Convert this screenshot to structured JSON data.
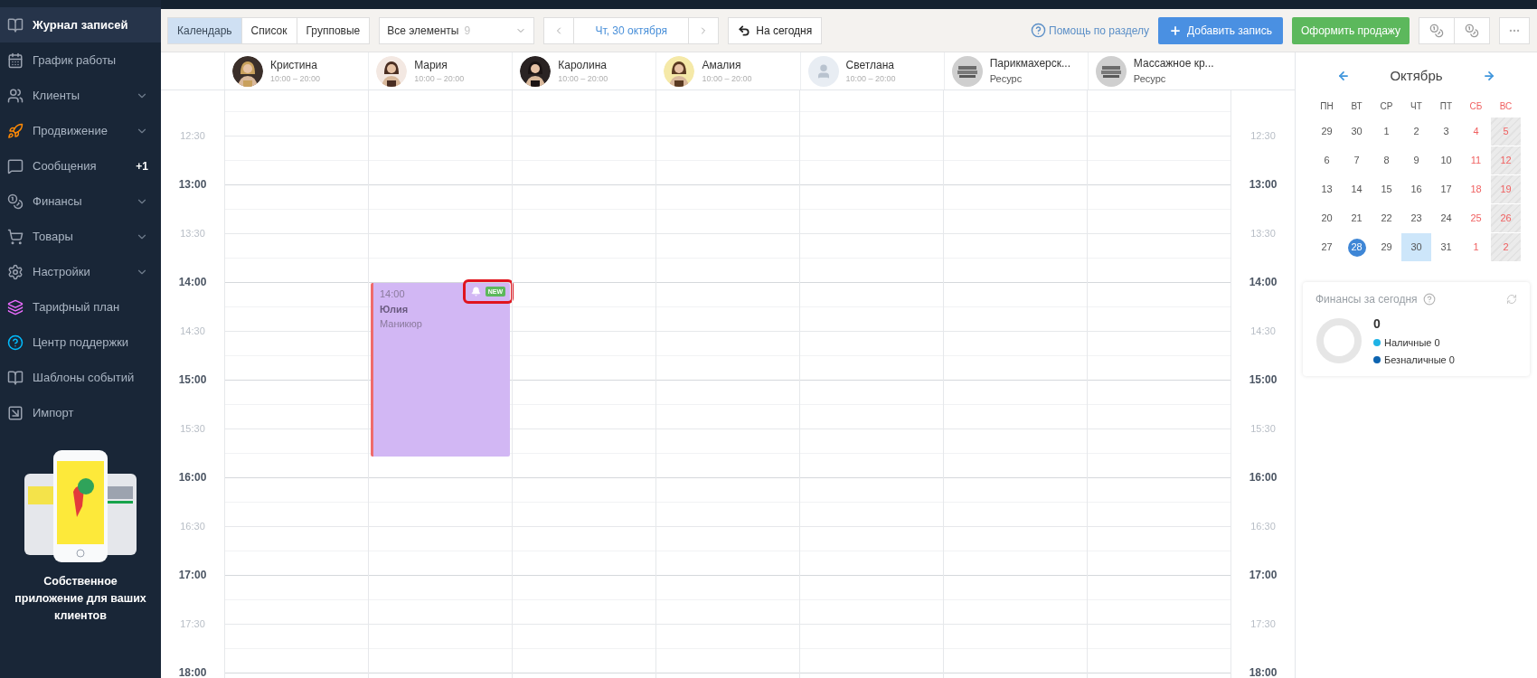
{
  "sidebar": {
    "items": [
      {
        "label": "Журнал записей",
        "selected": true,
        "expandable": false
      },
      {
        "label": "График работы",
        "selected": false,
        "expandable": false
      },
      {
        "label": "Клиенты",
        "selected": false,
        "expandable": true
      },
      {
        "label": "Продвижение",
        "selected": false,
        "expandable": true
      },
      {
        "label": "Сообщения",
        "selected": false,
        "expandable": false,
        "badge": "+1"
      },
      {
        "label": "Финансы",
        "selected": false,
        "expandable": true
      },
      {
        "label": "Товары",
        "selected": false,
        "expandable": true
      },
      {
        "label": "Настройки",
        "selected": false,
        "expandable": true
      },
      {
        "label": "Тарифный план",
        "selected": false,
        "expandable": false
      },
      {
        "label": "Центр поддержки",
        "selected": false,
        "expandable": false
      },
      {
        "label": "Шаблоны событий",
        "selected": false,
        "expandable": false
      },
      {
        "label": "Импорт",
        "selected": false,
        "expandable": false
      }
    ],
    "promo": {
      "text": "Собственное приложение для ваших клиентов"
    }
  },
  "toolbar": {
    "view_tabs": [
      {
        "label": "Календарь",
        "selected": true
      },
      {
        "label": "Список",
        "selected": false
      },
      {
        "label": "Групповые",
        "selected": false
      }
    ],
    "filter": {
      "value": "Все элементы",
      "count": "9"
    },
    "date": "Чт, 30 октября",
    "today_button": "На сегодня",
    "help_link": "Помощь по разделу",
    "add_button": "Добавить запись",
    "sale_button": "Оформить продажу"
  },
  "staff": [
    {
      "name": "Кристина",
      "subtitle": "10:00 – 20:00"
    },
    {
      "name": "Мария",
      "subtitle": "10:00 – 20:00",
      "events": [
        {
          "time": "14:00",
          "client": "Юлия",
          "service": "Маникюр",
          "badge": "NEW",
          "highlighted": true
        }
      ]
    },
    {
      "name": "Каролина",
      "subtitle": "10:00 – 20:00"
    },
    {
      "name": "Амалия",
      "subtitle": "10:00 – 20:00"
    },
    {
      "name": "Светлана",
      "subtitle": "10:00 – 20:00",
      "kind": "placeholder"
    },
    {
      "name": "Парикмахерск...",
      "subtitle": "Ресурс",
      "kind": "resource"
    },
    {
      "name": "Массажное кр...",
      "subtitle": "Ресурс",
      "kind": "resource"
    }
  ],
  "time_labels_left": [
    {
      "label": "12:30",
      "kind": "half"
    },
    {
      "label": "13:00",
      "kind": "hour"
    },
    {
      "label": "13:30",
      "kind": "half"
    },
    {
      "label": "14:00",
      "kind": "hour"
    },
    {
      "label": "14:30",
      "kind": "half"
    },
    {
      "label": "15:00",
      "kind": "hour"
    },
    {
      "label": "15:30",
      "kind": "half"
    },
    {
      "label": "16:00",
      "kind": "hour"
    },
    {
      "label": "16:30",
      "kind": "half"
    },
    {
      "label": "17:00",
      "kind": "hour"
    },
    {
      "label": "17:30",
      "kind": "half"
    },
    {
      "label": "18:00",
      "kind": "hour"
    }
  ],
  "time_labels_right": [
    {
      "label": "12:30",
      "kind": "half"
    },
    {
      "label": "13:00",
      "kind": "hour"
    },
    {
      "label": "13:30",
      "kind": "half"
    },
    {
      "label": "14:00",
      "kind": "hour"
    },
    {
      "label": "14:30",
      "kind": "half"
    },
    {
      "label": "15:00",
      "kind": "hour"
    },
    {
      "label": "15:30",
      "kind": "half"
    },
    {
      "label": "16:00",
      "kind": "hour"
    },
    {
      "label": "16:30",
      "kind": "half"
    },
    {
      "label": "17:00",
      "kind": "hour"
    },
    {
      "label": "17:30",
      "kind": "half"
    },
    {
      "label": "18:00",
      "kind": "hour"
    }
  ],
  "mini_calendar": {
    "month": "Октябрь",
    "weekdays": [
      {
        "label": "ПН",
        "weekend": false
      },
      {
        "label": "ВТ",
        "weekend": false
      },
      {
        "label": "СР",
        "weekend": false
      },
      {
        "label": "ЧТ",
        "weekend": false
      },
      {
        "label": "ПТ",
        "weekend": false
      },
      {
        "label": "СБ",
        "weekend": true
      },
      {
        "label": "ВС",
        "weekend": true
      }
    ],
    "weeks": [
      [
        {
          "label": "29",
          "weekend": false,
          "day_off": false,
          "selected": false,
          "today": false
        },
        {
          "label": "30",
          "weekend": false,
          "day_off": false,
          "selected": false,
          "today": false
        },
        {
          "label": "1",
          "weekend": false,
          "day_off": false,
          "selected": false,
          "today": false
        },
        {
          "label": "2",
          "weekend": false,
          "day_off": false,
          "selected": false,
          "today": false
        },
        {
          "label": "3",
          "weekend": false,
          "day_off": false,
          "selected": false,
          "today": false
        },
        {
          "label": "4",
          "weekend": true,
          "day_off": false,
          "selected": false,
          "today": false
        },
        {
          "label": "5",
          "weekend": true,
          "day_off": true,
          "selected": false,
          "today": false
        }
      ],
      [
        {
          "label": "6",
          "weekend": false,
          "day_off": false,
          "selected": false,
          "today": false
        },
        {
          "label": "7",
          "weekend": false,
          "day_off": false,
          "selected": false,
          "today": false
        },
        {
          "label": "8",
          "weekend": false,
          "day_off": false,
          "selected": false,
          "today": false
        },
        {
          "label": "9",
          "weekend": false,
          "day_off": false,
          "selected": false,
          "today": false
        },
        {
          "label": "10",
          "weekend": false,
          "day_off": false,
          "selected": false,
          "today": false
        },
        {
          "label": "11",
          "weekend": true,
          "day_off": false,
          "selected": false,
          "today": false
        },
        {
          "label": "12",
          "weekend": true,
          "day_off": true,
          "selected": false,
          "today": false
        }
      ],
      [
        {
          "label": "13",
          "weekend": false,
          "day_off": false,
          "selected": false,
          "today": false
        },
        {
          "label": "14",
          "weekend": false,
          "day_off": false,
          "selected": false,
          "today": false
        },
        {
          "label": "15",
          "weekend": false,
          "day_off": false,
          "selected": false,
          "today": false
        },
        {
          "label": "16",
          "weekend": false,
          "day_off": false,
          "selected": false,
          "today": false
        },
        {
          "label": "17",
          "weekend": false,
          "day_off": false,
          "selected": false,
          "today": false
        },
        {
          "label": "18",
          "weekend": true,
          "day_off": false,
          "selected": false,
          "today": false
        },
        {
          "label": "19",
          "weekend": true,
          "day_off": true,
          "selected": false,
          "today": false
        }
      ],
      [
        {
          "label": "20",
          "weekend": false,
          "day_off": false,
          "selected": false,
          "today": false
        },
        {
          "label": "21",
          "weekend": false,
          "day_off": false,
          "selected": false,
          "today": false
        },
        {
          "label": "22",
          "weekend": false,
          "day_off": false,
          "selected": false,
          "today": false
        },
        {
          "label": "23",
          "weekend": false,
          "day_off": false,
          "selected": false,
          "today": false
        },
        {
          "label": "24",
          "weekend": false,
          "day_off": false,
          "selected": false,
          "today": false
        },
        {
          "label": "25",
          "weekend": true,
          "day_off": false,
          "selected": false,
          "today": false
        },
        {
          "label": "26",
          "weekend": true,
          "day_off": true,
          "selected": false,
          "today": false
        }
      ],
      [
        {
          "label": "27",
          "weekend": false,
          "day_off": false,
          "selected": false,
          "today": false
        },
        {
          "label": "28",
          "weekend": false,
          "day_off": false,
          "selected": false,
          "today": true
        },
        {
          "label": "29",
          "weekend": false,
          "day_off": false,
          "selected": false,
          "today": false
        },
        {
          "label": "30",
          "weekend": false,
          "day_off": false,
          "selected": true,
          "today": false
        },
        {
          "label": "31",
          "weekend": false,
          "day_off": false,
          "selected": false,
          "today": false
        },
        {
          "label": "1",
          "weekend": true,
          "day_off": false,
          "selected": false,
          "today": false
        },
        {
          "label": "2",
          "weekend": true,
          "day_off": true,
          "selected": false,
          "today": false
        }
      ]
    ]
  },
  "finances": {
    "title": "Финансы за сегодня",
    "total": "0",
    "legend": [
      {
        "label": "Наличные",
        "value": "0",
        "color": "#1fb3e6"
      },
      {
        "label": "Безналичные",
        "value": "0",
        "color": "#0d64b0"
      }
    ]
  }
}
